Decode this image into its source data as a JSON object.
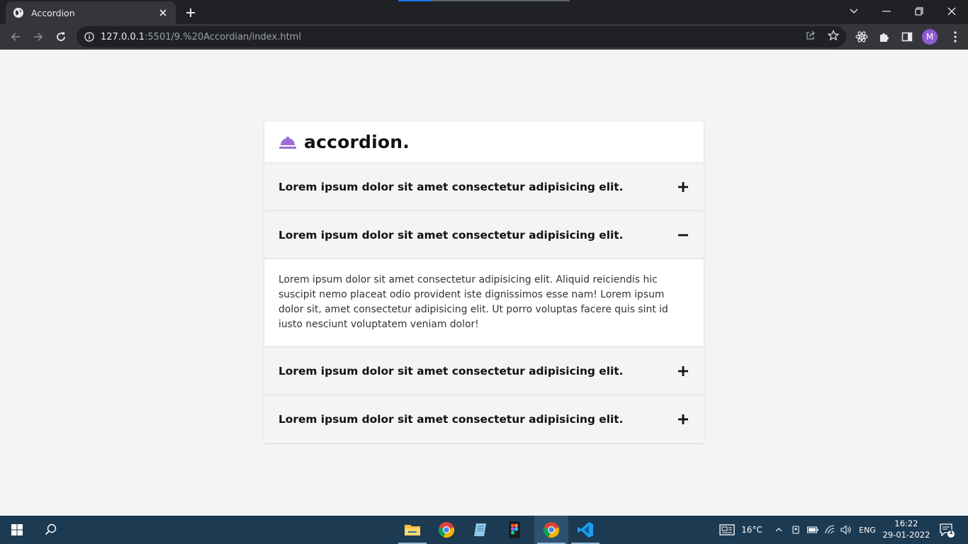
{
  "browser": {
    "tab_title": "Accordion",
    "url_host": "127.0.0.1",
    "url_rest": ":5501/9.%20Accordian/index.html",
    "profile_initial": "M"
  },
  "accordion": {
    "heading": "accordion.",
    "accent_color": "#9b6ed6",
    "items": [
      {
        "question": "Lorem ipsum dolor sit amet consectetur adipisicing elit.",
        "expanded": false,
        "toggle_icon": "plus-icon"
      },
      {
        "question": "Lorem ipsum dolor sit amet consectetur adipisicing elit.",
        "expanded": true,
        "toggle_icon": "minus-icon",
        "answer": "Lorem ipsum dolor sit amet consectetur adipisicing elit. Aliquid reiciendis hic suscipit nemo placeat odio provident iste dignissimos esse nam! Lorem ipsum dolor sit, amet consectetur adipisicing elit. Ut porro voluptas facere quis sint id iusto nesciunt voluptatem veniam dolor!"
      },
      {
        "question": "Lorem ipsum dolor sit amet consectetur adipisicing elit.",
        "expanded": false,
        "toggle_icon": "plus-icon"
      },
      {
        "question": "Lorem ipsum dolor sit amet consectetur adipisicing elit.",
        "expanded": false,
        "toggle_icon": "plus-icon"
      }
    ]
  },
  "taskbar": {
    "weather": "16°C",
    "language": "ENG",
    "time": "16:22",
    "date": "29-01-2022",
    "notification_count": "1"
  }
}
